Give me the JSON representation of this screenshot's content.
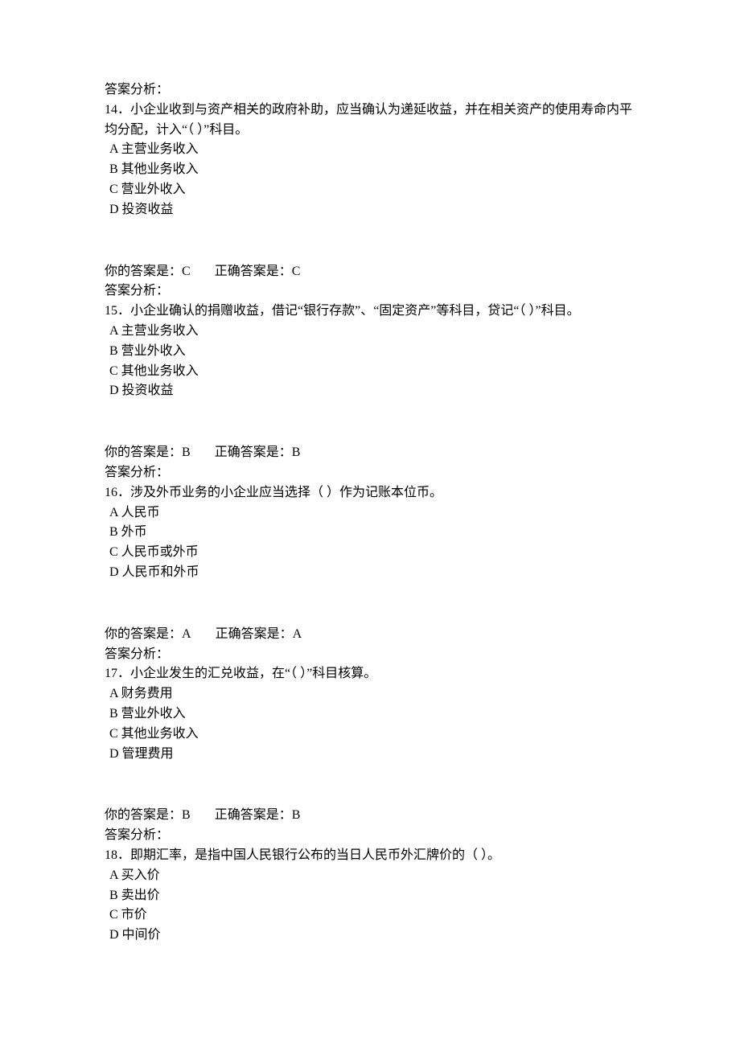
{
  "labels": {
    "analysis": "答案分析：",
    "your": "你的答案是：",
    "correct": "正确答案是："
  },
  "questions": [
    {
      "num": "14",
      "stem": "．小企业收到与资产相关的政府补助，应当确认为递延收益，并在相关资产的使用寿命内平均分配，计入“（ ）”科目。",
      "options": [
        "A 主营业务收入",
        "B 其他业务收入",
        "C 营业外收入",
        "D 投资收益"
      ],
      "your": "C",
      "correct": "C"
    },
    {
      "num": "15",
      "stem": "．小企业确认的捐赠收益，借记“银行存款”、“固定资产”等科目，贷记“（ ）”科目。",
      "options": [
        "A 主营业务收入",
        "B 营业外收入",
        "C 其他业务收入",
        "D 投资收益"
      ],
      "your": "B",
      "correct": "B"
    },
    {
      "num": "16",
      "stem": "．涉及外币业务的小企业应当选择（ ）作为记账本位币。",
      "options": [
        "A 人民币",
        "B 外币",
        "C 人民币或外币",
        "D 人民币和外币"
      ],
      "your": "A",
      "correct": "A"
    },
    {
      "num": "17",
      "stem": "．小企业发生的汇兑收益，在“（ ）”科目核算。",
      "options": [
        "A 财务费用",
        "B 营业外收入",
        "C 其他业务收入",
        "D 管理费用"
      ],
      "your": "B",
      "correct": "B"
    },
    {
      "num": "18",
      "stem": "．即期汇率，是指中国人民银行公布的当日人民币外汇牌价的（ ）。",
      "options": [
        "A 买入价",
        "B 卖出价",
        "C 市价",
        "D 中间价"
      ],
      "your": "",
      "correct": ""
    }
  ]
}
